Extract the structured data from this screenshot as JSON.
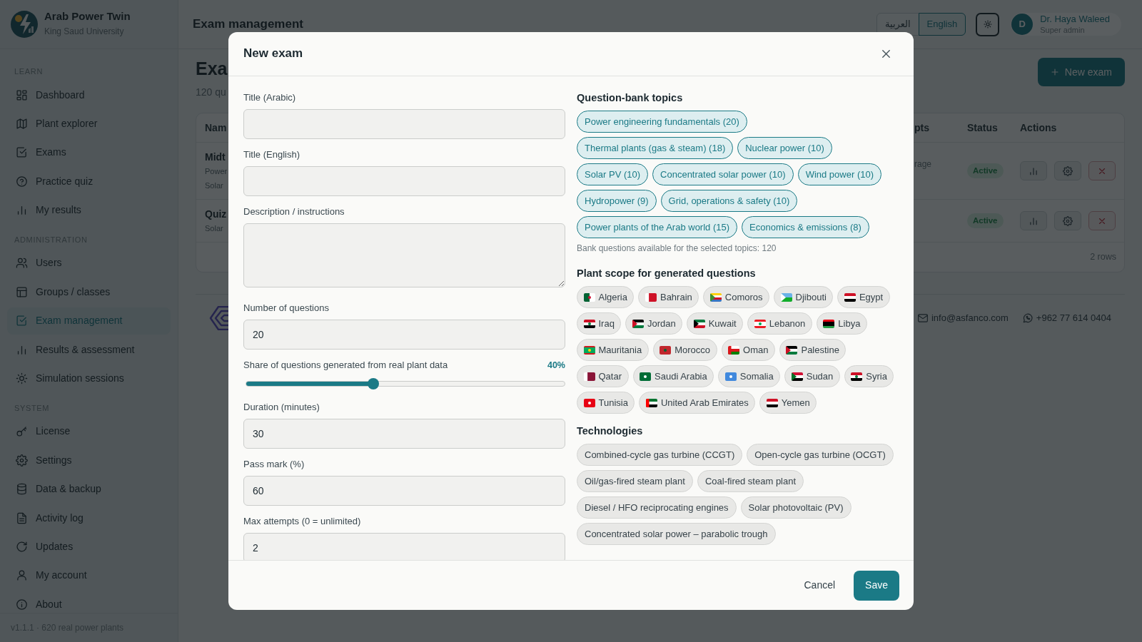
{
  "app": {
    "name": "Arab Power Twin",
    "organization": "King Saud University"
  },
  "sidebar": {
    "sections": [
      {
        "title": "LEARN",
        "items": [
          {
            "label": "Dashboard",
            "selected": false
          },
          {
            "label": "Plant explorer",
            "selected": false
          },
          {
            "label": "Exams",
            "selected": false
          },
          {
            "label": "Practice quiz",
            "selected": false
          },
          {
            "label": "My results",
            "selected": false
          }
        ]
      },
      {
        "title": "ADMINISTRATION",
        "items": [
          {
            "label": "Users",
            "selected": false
          },
          {
            "label": "Groups / classes",
            "selected": false
          },
          {
            "label": "Exam management",
            "selected": true
          },
          {
            "label": "Results & assessment",
            "selected": false
          },
          {
            "label": "Simulation sessions",
            "selected": false
          }
        ]
      },
      {
        "title": "SYSTEM",
        "items": [
          {
            "label": "License",
            "selected": false
          },
          {
            "label": "Settings",
            "selected": false
          },
          {
            "label": "Data & backup",
            "selected": false
          },
          {
            "label": "Activity log",
            "selected": false
          },
          {
            "label": "Updates",
            "selected": false
          },
          {
            "label": "My account",
            "selected": false
          },
          {
            "label": "About",
            "selected": false
          }
        ]
      }
    ],
    "footer": "v1.1.1 · 620 real power plants"
  },
  "header": {
    "title": "Exam management",
    "languages": [
      {
        "label": "العربية",
        "selected": false
      },
      {
        "label": "English",
        "selected": true
      }
    ],
    "user": {
      "initial": "D",
      "name": "Dr. Haya Waleed",
      "role": "Super admin"
    }
  },
  "page": {
    "title": "Exa",
    "subtitle": "120 qu",
    "new_button": "New exam",
    "table": {
      "columns": [
        "Nam",
        "pts",
        "Status",
        "Actions"
      ],
      "rows": [
        {
          "name": "Midt",
          "details": [
            "Power",
            "Solar"
          ],
          "column_2": "rage",
          "status": "Active"
        },
        {
          "name": "Quiz",
          "details": [
            "Solar"
          ],
          "status": "Active"
        }
      ],
      "footer": "2 rows"
    },
    "contacts": {
      "email": "info@asfanco.com",
      "phone": "+962 77 614 0404"
    }
  },
  "modal": {
    "title": "New exam",
    "fields": [
      {
        "kind": "input",
        "label": "Title (Arabic)"
      },
      {
        "kind": "input",
        "label": "Title (English)"
      },
      {
        "kind": "textarea",
        "label": "Description / instructions"
      },
      {
        "kind": "input",
        "label": "Number of questions",
        "value": "20"
      },
      {
        "kind": "slider",
        "label": "Share of questions generated from real plant data",
        "reading": "40%",
        "level": 0.4
      },
      {
        "kind": "input",
        "label": "Duration (minutes)",
        "value": "30"
      },
      {
        "kind": "input",
        "label": "Pass mark (%)",
        "value": "60"
      },
      {
        "kind": "input",
        "label": "Max attempts (0 = unlimited)",
        "value": "2"
      }
    ],
    "topics": {
      "title": "Question-bank topics",
      "items": [
        {
          "label": "Power engineering fundamentals (20)",
          "selected": true
        },
        {
          "label": "Thermal plants (gas & steam) (18)",
          "selected": true
        },
        {
          "label": "Nuclear power (10)",
          "selected": true
        },
        {
          "label": "Solar PV (10)",
          "selected": true
        },
        {
          "label": "Concentrated solar power (10)",
          "selected": true
        },
        {
          "label": "Wind power (10)",
          "selected": true
        },
        {
          "label": "Hydropower (9)",
          "selected": true
        },
        {
          "label": "Grid, operations & safety (10)",
          "selected": true
        },
        {
          "label": "Power plants of the Arab world (15)",
          "selected": true
        },
        {
          "label": "Economics & emissions (8)",
          "selected": true
        }
      ],
      "note": "Bank questions available for the selected topics: 120"
    },
    "plant_scope": {
      "title": "Plant scope for generated questions",
      "items": [
        {
          "label": "Algeria",
          "selected": false
        },
        {
          "label": "Bahrain",
          "selected": false
        },
        {
          "label": "Comoros",
          "selected": false
        },
        {
          "label": "Djibouti",
          "selected": false
        },
        {
          "label": "Egypt",
          "selected": false
        },
        {
          "label": "Iraq",
          "selected": false
        },
        {
          "label": "Jordan",
          "selected": false
        },
        {
          "label": "Kuwait",
          "selected": false
        },
        {
          "label": "Lebanon",
          "selected": false
        },
        {
          "label": "Libya",
          "selected": false
        },
        {
          "label": "Mauritania",
          "selected": false
        },
        {
          "label": "Morocco",
          "selected": false
        },
        {
          "label": "Oman",
          "selected": false
        },
        {
          "label": "Palestine",
          "selected": false
        },
        {
          "label": "Qatar",
          "selected": false
        },
        {
          "label": "Saudi Arabia",
          "selected": false
        },
        {
          "label": "Somalia",
          "selected": false
        },
        {
          "label": "Sudan",
          "selected": false
        },
        {
          "label": "Syria",
          "selected": false
        },
        {
          "label": "Tunisia",
          "selected": false
        },
        {
          "label": "United Arab Emirates",
          "selected": false
        },
        {
          "label": "Yemen",
          "selected": false
        }
      ]
    },
    "technologies": {
      "title": "Technologies",
      "items": [
        {
          "label": "Combined-cycle gas turbine (CCGT)",
          "selected": false
        },
        {
          "label": "Open-cycle gas turbine (OCGT)",
          "selected": false
        },
        {
          "label": "Oil/gas-fired steam plant",
          "selected": false
        },
        {
          "label": "Coal-fired steam plant",
          "selected": false
        },
        {
          "label": "Diesel / HFO reciprocating engines",
          "selected": false
        },
        {
          "label": "Solar photovoltaic (PV)",
          "selected": false
        },
        {
          "label": "Concentrated solar power – parabolic trough",
          "selected": false
        }
      ]
    },
    "buttons": [
      {
        "label": "Cancel",
        "kind": "link"
      },
      {
        "label": "Save",
        "kind": "primary"
      }
    ]
  }
}
